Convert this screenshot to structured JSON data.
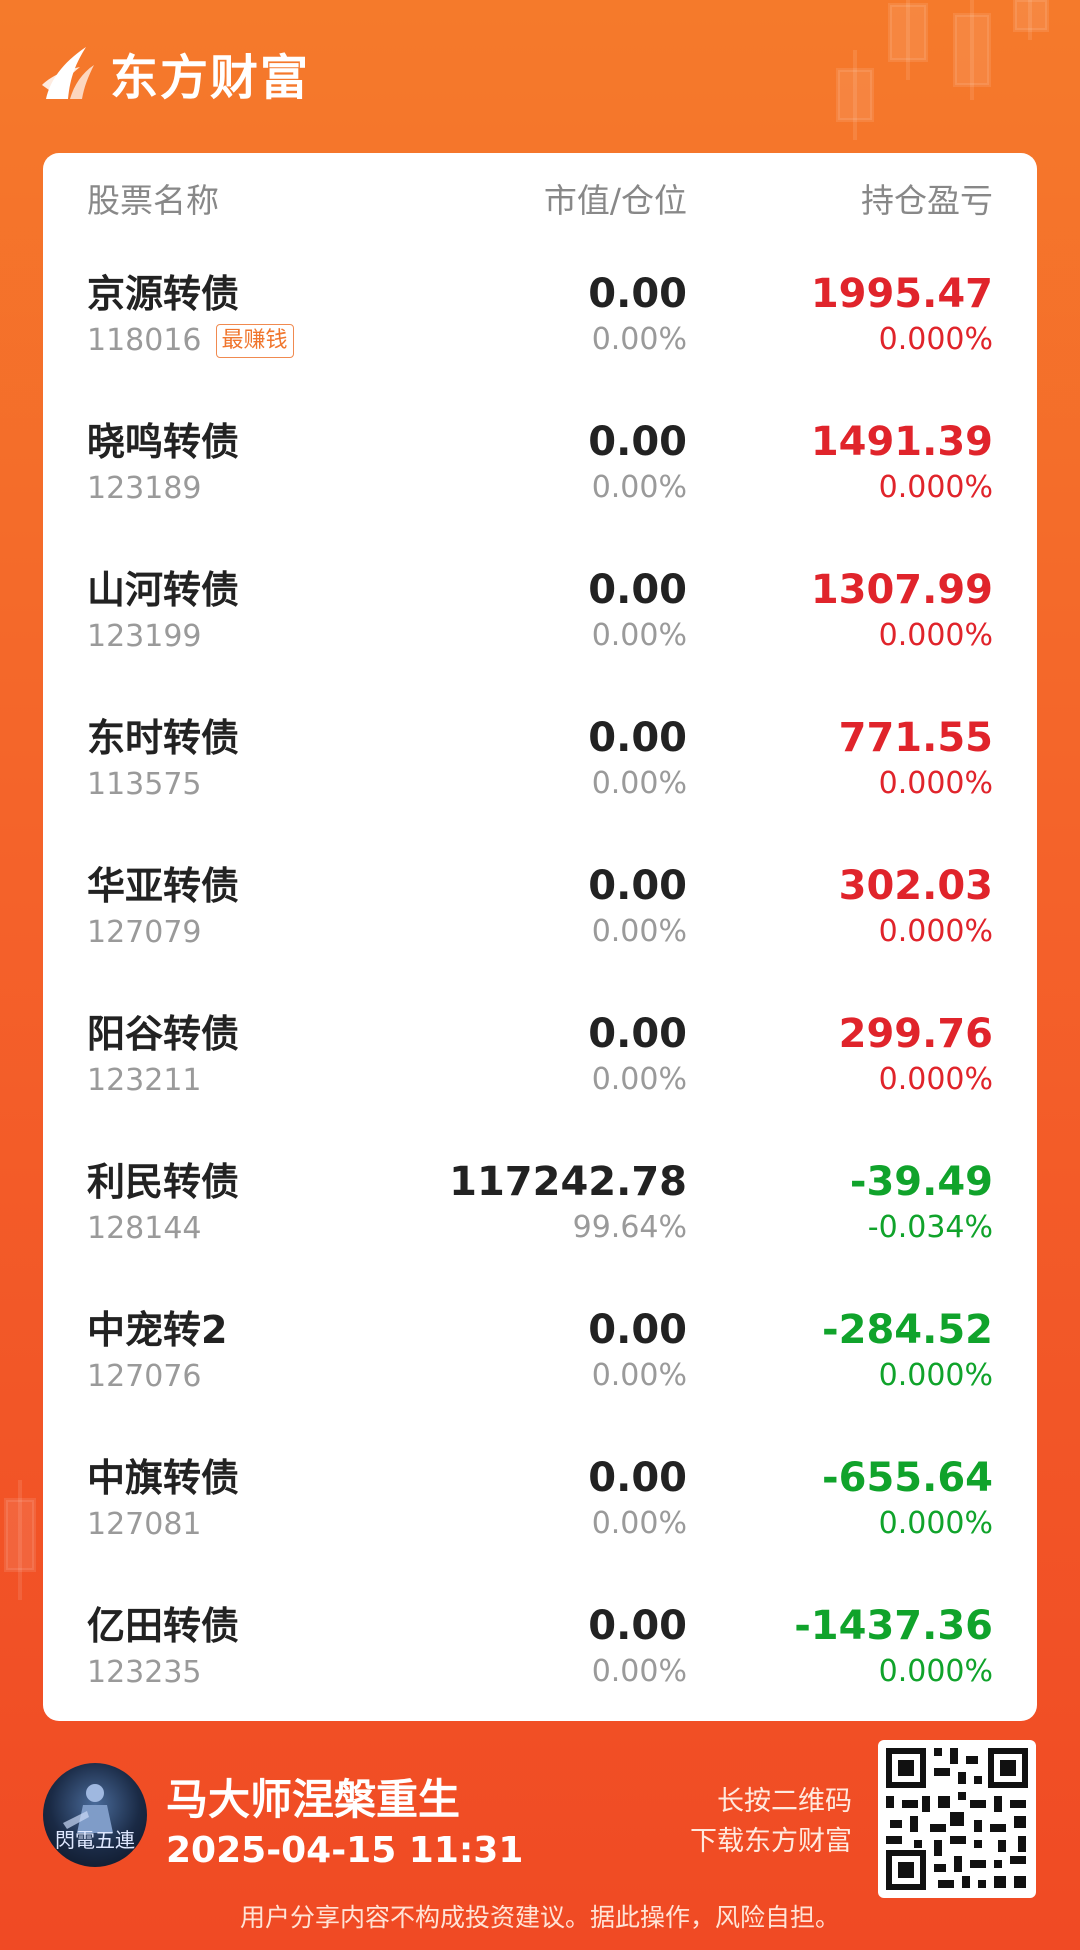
{
  "header": {
    "brand": "东方财富"
  },
  "columns": {
    "name": "股票名称",
    "value": "市值/仓位",
    "pl": "持仓盈亏"
  },
  "rows": [
    {
      "name": "京源转债",
      "code": "118016",
      "badge": "最赚钱",
      "value": "0.00",
      "position": "0.00%",
      "pl": "1995.47",
      "pl_pct": "0.000%",
      "trend": "pos"
    },
    {
      "name": "晓鸣转债",
      "code": "123189",
      "badge": "",
      "value": "0.00",
      "position": "0.00%",
      "pl": "1491.39",
      "pl_pct": "0.000%",
      "trend": "pos"
    },
    {
      "name": "山河转债",
      "code": "123199",
      "badge": "",
      "value": "0.00",
      "position": "0.00%",
      "pl": "1307.99",
      "pl_pct": "0.000%",
      "trend": "pos"
    },
    {
      "name": "东时转债",
      "code": "113575",
      "badge": "",
      "value": "0.00",
      "position": "0.00%",
      "pl": "771.55",
      "pl_pct": "0.000%",
      "trend": "pos"
    },
    {
      "name": "华亚转债",
      "code": "127079",
      "badge": "",
      "value": "0.00",
      "position": "0.00%",
      "pl": "302.03",
      "pl_pct": "0.000%",
      "trend": "pos"
    },
    {
      "name": "阳谷转债",
      "code": "123211",
      "badge": "",
      "value": "0.00",
      "position": "0.00%",
      "pl": "299.76",
      "pl_pct": "0.000%",
      "trend": "pos"
    },
    {
      "name": "利民转债",
      "code": "128144",
      "badge": "",
      "value": "117242.78",
      "position": "99.64%",
      "pl": "-39.49",
      "pl_pct": "-0.034%",
      "trend": "neg"
    },
    {
      "name": "中宠转2",
      "code": "127076",
      "badge": "",
      "value": "0.00",
      "position": "0.00%",
      "pl": "-284.52",
      "pl_pct": "0.000%",
      "trend": "neg"
    },
    {
      "name": "中旗转债",
      "code": "127081",
      "badge": "",
      "value": "0.00",
      "position": "0.00%",
      "pl": "-655.64",
      "pl_pct": "0.000%",
      "trend": "neg"
    },
    {
      "name": "亿田转债",
      "code": "123235",
      "badge": "",
      "value": "0.00",
      "position": "0.00%",
      "pl": "-1437.36",
      "pl_pct": "0.000%",
      "trend": "neg"
    }
  ],
  "footer": {
    "user_name": "马大师涅槃重生",
    "timestamp": "2025-04-15 11:31",
    "avatar_text": "閃電五連",
    "qr_hint_line1": "长按二维码",
    "qr_hint_line2": "下载东方财富",
    "disclaimer": "用户分享内容不构成投资建议。据此操作，风险自担。"
  },
  "colors": {
    "positive": "#e0242b",
    "negative": "#10a32b",
    "background_top": "#f57a2b",
    "background_bottom": "#f04a24"
  },
  "icons": {
    "logo": "eastmoney-logo-icon",
    "qr": "qr-code-icon"
  }
}
